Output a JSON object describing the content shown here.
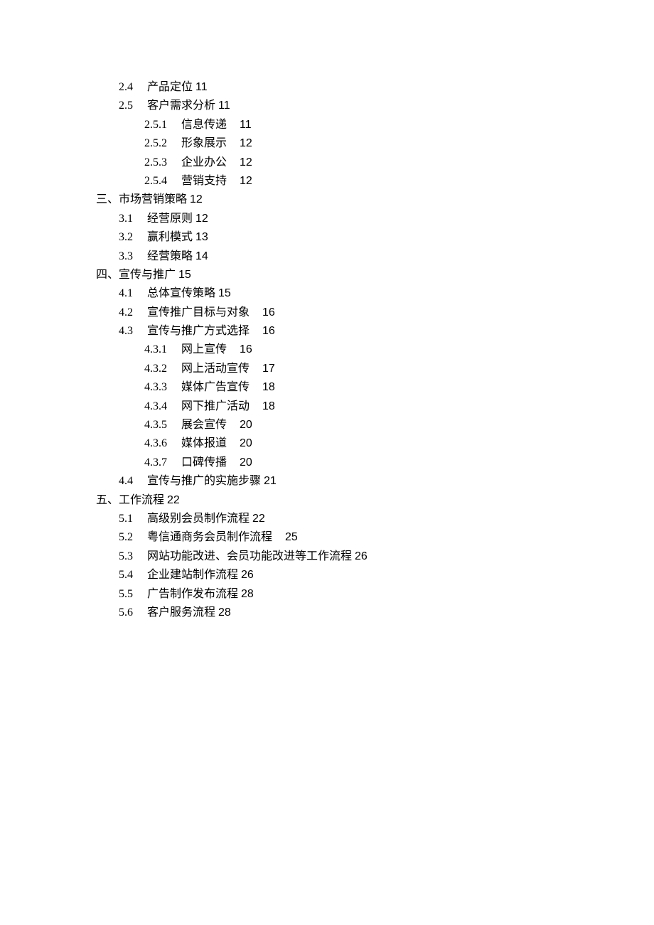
{
  "toc": [
    {
      "level": 1,
      "num": "2.4",
      "title": "产品定位",
      "page": "11",
      "gap": "sm"
    },
    {
      "level": 1,
      "num": "2.5",
      "title": "客户需求分析",
      "page": "11",
      "gap": "sm"
    },
    {
      "level": 2,
      "num": "2.5.1",
      "title": "信息传递",
      "page": "11",
      "gap": "lg"
    },
    {
      "level": 2,
      "num": "2.5.2",
      "title": "形象展示",
      "page": "12",
      "gap": "lg"
    },
    {
      "level": 2,
      "num": "2.5.3",
      "title": "企业办公",
      "page": "12",
      "gap": "lg"
    },
    {
      "level": 2,
      "num": "2.5.4",
      "title": "营销支持",
      "page": "12",
      "gap": "lg"
    },
    {
      "level": 0,
      "num": "三、",
      "title": "市场营销策略",
      "page": "12",
      "gap": "sm"
    },
    {
      "level": 1,
      "num": "3.1",
      "title": "经营原则",
      "page": "12",
      "gap": "sm"
    },
    {
      "level": 1,
      "num": "3.2",
      "title": "赢利模式",
      "page": "13",
      "gap": "sm"
    },
    {
      "level": 1,
      "num": "3.3",
      "title": "经营策略",
      "page": "14",
      "gap": "sm"
    },
    {
      "level": 0,
      "num": "四、",
      "title": "宣传与推广",
      "page": "15",
      "gap": "sm"
    },
    {
      "level": 1,
      "num": "4.1",
      "title": "总体宣传策略",
      "page": "15",
      "gap": "sm"
    },
    {
      "level": 1,
      "num": "4.2",
      "title": "宣传推广目标与对象",
      "page": "16",
      "gap": "lg"
    },
    {
      "level": 1,
      "num": "4.3",
      "title": "宣传与推广方式选择",
      "page": "16",
      "gap": "lg"
    },
    {
      "level": 2,
      "num": "4.3.1",
      "title": "网上宣传",
      "page": "16",
      "gap": "lg"
    },
    {
      "level": 2,
      "num": "4.3.2",
      "title": "网上活动宣传",
      "page": "17",
      "gap": "lg"
    },
    {
      "level": 2,
      "num": "4.3.3",
      "title": "媒体广告宣传",
      "page": "18",
      "gap": "lg"
    },
    {
      "level": 2,
      "num": "4.3.4",
      "title": "网下推广活动",
      "page": "18",
      "gap": "lg"
    },
    {
      "level": 2,
      "num": "4.3.5",
      "title": "展会宣传",
      "page": "20",
      "gap": "lg"
    },
    {
      "level": 2,
      "num": "4.3.6",
      "title": "媒体报道",
      "page": "20",
      "gap": "lg"
    },
    {
      "level": 2,
      "num": "4.3.7",
      "title": "口碑传播",
      "page": "20",
      "gap": "lg"
    },
    {
      "level": 1,
      "num": "4.4",
      "title": "宣传与推广的实施步骤",
      "page": "21",
      "gap": "sm"
    },
    {
      "level": 0,
      "num": "五、",
      "title": "工作流程",
      "page": "22",
      "gap": "sm"
    },
    {
      "level": 1,
      "num": "5.1",
      "title": "高级别会员制作流程",
      "page": "22",
      "gap": "sm"
    },
    {
      "level": 1,
      "num": "5.2",
      "title": "粤信通商务会员制作流程",
      "page": "25",
      "gap": "lg"
    },
    {
      "level": 1,
      "num": "5.3",
      "title": "网站功能改进、会员功能改进等工作流程",
      "page": "26",
      "gap": "sm"
    },
    {
      "level": 1,
      "num": "5.4",
      "title": "企业建站制作流程",
      "page": "26",
      "gap": "sm"
    },
    {
      "level": 1,
      "num": "5.5",
      "title": "广告制作发布流程",
      "page": "28",
      "gap": "sm"
    },
    {
      "level": 1,
      "num": "5.6",
      "title": "客户服务流程",
      "page": "28",
      "gap": "sm"
    }
  ]
}
